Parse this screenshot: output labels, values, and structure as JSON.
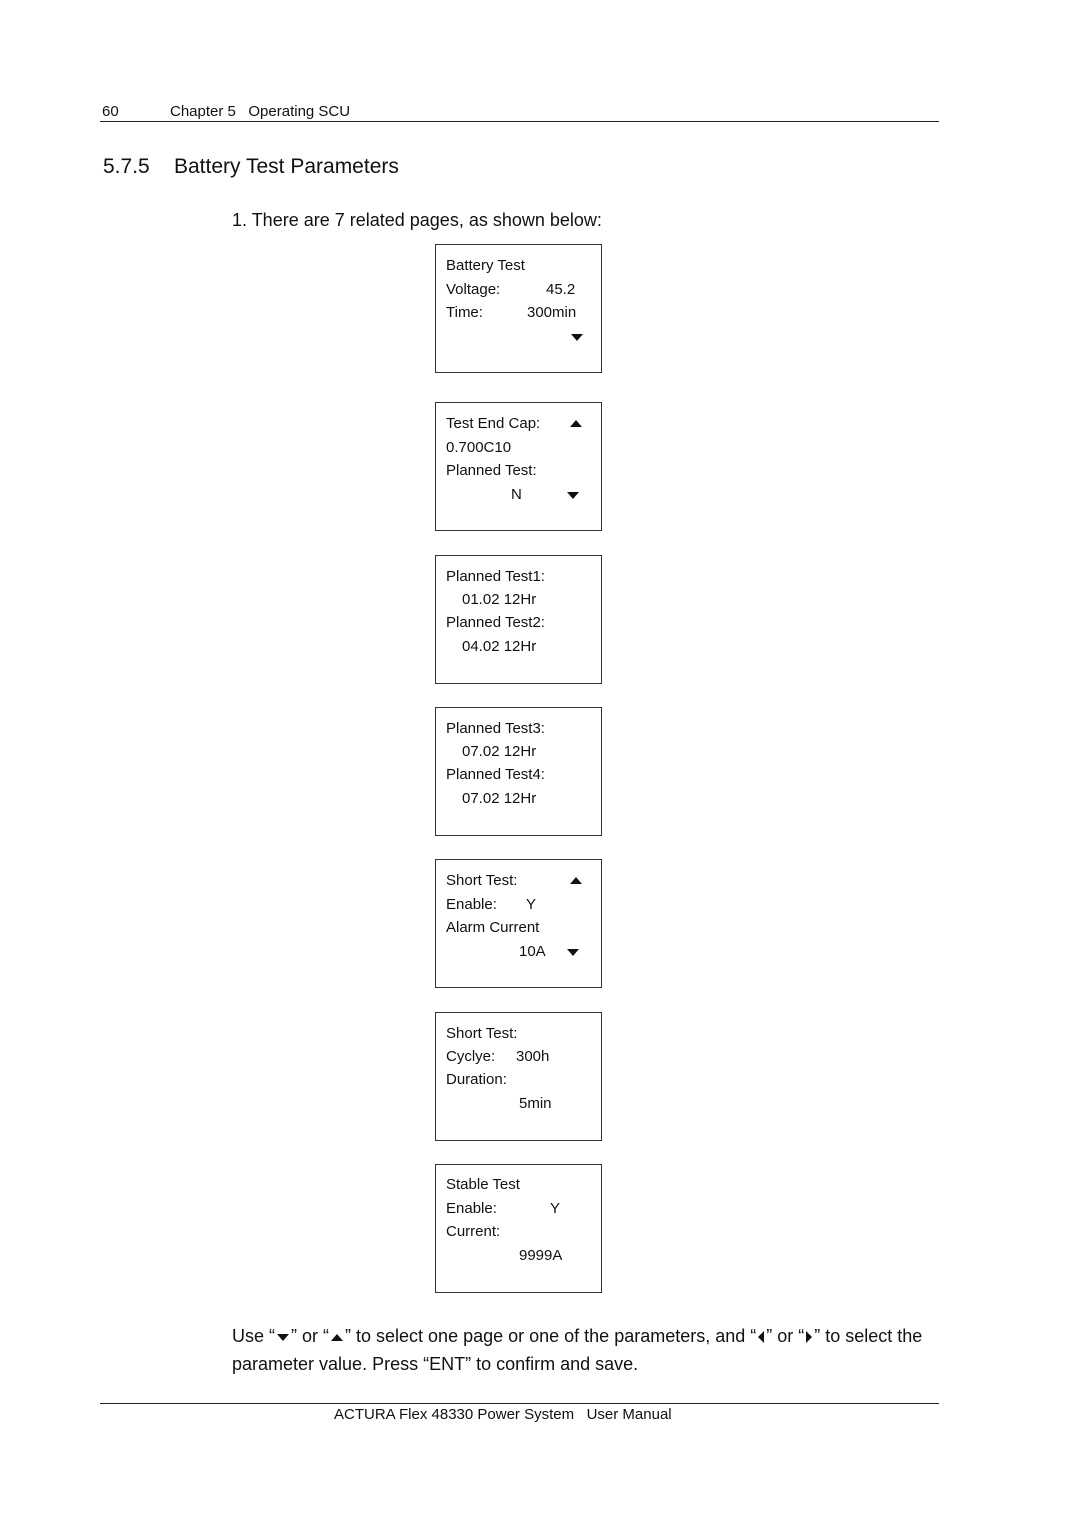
{
  "header": {
    "page_number": "60",
    "chapter": "Chapter 5   Operating SCU"
  },
  "section": {
    "number": "5.7.5",
    "title": "Battery Test Parameters"
  },
  "intro": "1. There are 7 related pages, as shown below:",
  "lcd_pages": [
    {
      "lines": [
        "Battery Test",
        "Voltage:",
        "Time:"
      ],
      "values": [
        "45.2",
        "300min"
      ],
      "arrows": [
        "down"
      ]
    },
    {
      "lines": [
        "Test End Cap:",
        "0.700C10",
        "Planned Test:",
        "N"
      ],
      "arrows": [
        "up",
        "down"
      ]
    },
    {
      "lines": [
        "Planned Test1:",
        "01.02 12Hr",
        "Planned Test2:",
        "04.02 12Hr"
      ],
      "arrows": []
    },
    {
      "lines": [
        "Planned Test3:",
        "07.02 12Hr",
        "Planned Test4:",
        "07.02 12Hr"
      ],
      "arrows": []
    },
    {
      "lines": [
        "Short Test:",
        "Enable:",
        "Alarm Current",
        "10A"
      ],
      "values": [
        "Y"
      ],
      "arrows": [
        "up",
        "down"
      ]
    },
    {
      "lines": [
        "Short Test:",
        "Cyclye:",
        "Duration:",
        "5min"
      ],
      "values": [
        "300h"
      ],
      "arrows": []
    },
    {
      "lines": [
        "Stable Test",
        "Enable:",
        "Current:",
        "9999A"
      ],
      "values": [
        "Y"
      ],
      "arrows": []
    }
  ],
  "instructions": {
    "part1": "Use “",
    "part2": "” or “",
    "part3": "” to select one page or one of the parameters, and “",
    "part4": "” or “",
    "part5": "” to select the parameter value. Press “ENT” to confirm and save.",
    "icons": [
      "down-arrow",
      "up-arrow",
      "left-arrow",
      "right-arrow"
    ]
  },
  "footer": "ACTURA Flex 48330 Power System   User Manual"
}
